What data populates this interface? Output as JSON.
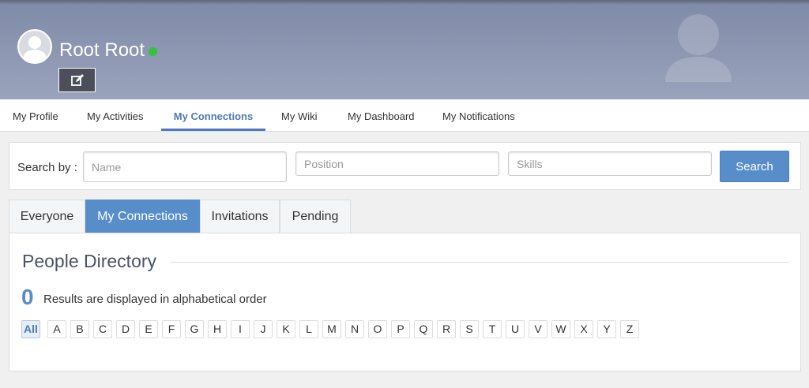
{
  "header": {
    "user_name": "Root Root",
    "status_color": "#34c23a"
  },
  "nav": {
    "items": [
      {
        "label": "My Profile",
        "active": false
      },
      {
        "label": "My Activities",
        "active": false
      },
      {
        "label": "My Connections",
        "active": true
      },
      {
        "label": "My Wiki",
        "active": false
      },
      {
        "label": "My Dashboard",
        "active": false
      },
      {
        "label": "My Notifications",
        "active": false
      }
    ]
  },
  "search": {
    "label": "Search by :",
    "name_placeholder": "Name",
    "position_placeholder": "Position",
    "skills_placeholder": "Skills",
    "button_label": "Search"
  },
  "directory_tabs": [
    {
      "label": "Everyone",
      "active": false
    },
    {
      "label": "My Connections",
      "active": true
    },
    {
      "label": "Invitations",
      "active": false
    },
    {
      "label": "Pending",
      "active": false
    }
  ],
  "directory": {
    "title": "People Directory",
    "result_count": "0",
    "result_text": "Results are displayed in alphabetical order",
    "letters": [
      "All",
      "A",
      "B",
      "C",
      "D",
      "E",
      "F",
      "G",
      "H",
      "I",
      "J",
      "K",
      "L",
      "M",
      "N",
      "O",
      "P",
      "Q",
      "R",
      "S",
      "T",
      "U",
      "V",
      "W",
      "X",
      "Y",
      "Z"
    ],
    "active_letter": "All"
  },
  "colors": {
    "accent": "#578dc9",
    "banner": "#8e98b3"
  }
}
